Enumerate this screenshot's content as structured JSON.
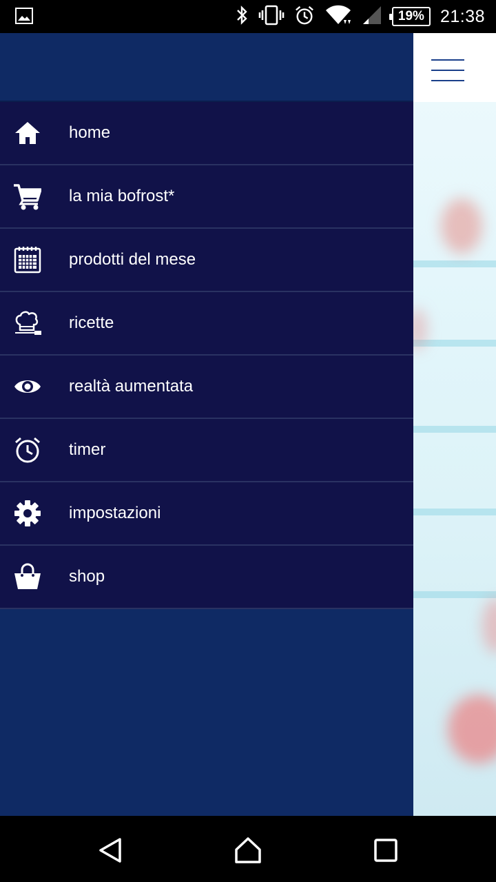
{
  "status_bar": {
    "battery": "19%",
    "time": "21:38"
  },
  "drawer": {
    "items": [
      {
        "label": "home",
        "icon": "home-icon"
      },
      {
        "label": "la mia bofrost*",
        "icon": "cart-icon"
      },
      {
        "label": "prodotti del mese",
        "icon": "calendar-icon"
      },
      {
        "label": "ricette",
        "icon": "chef-hat-icon"
      },
      {
        "label": "realtà aumentata",
        "icon": "eye-icon"
      },
      {
        "label": "timer",
        "icon": "alarm-clock-icon"
      },
      {
        "label": "impostazioni",
        "icon": "gear-icon"
      },
      {
        "label": "shop",
        "icon": "shopping-bag-icon"
      }
    ]
  },
  "colors": {
    "drawer_background": "#0f2a64",
    "menu_item_background": "#111249",
    "hamburger": "#1a3f8a"
  }
}
